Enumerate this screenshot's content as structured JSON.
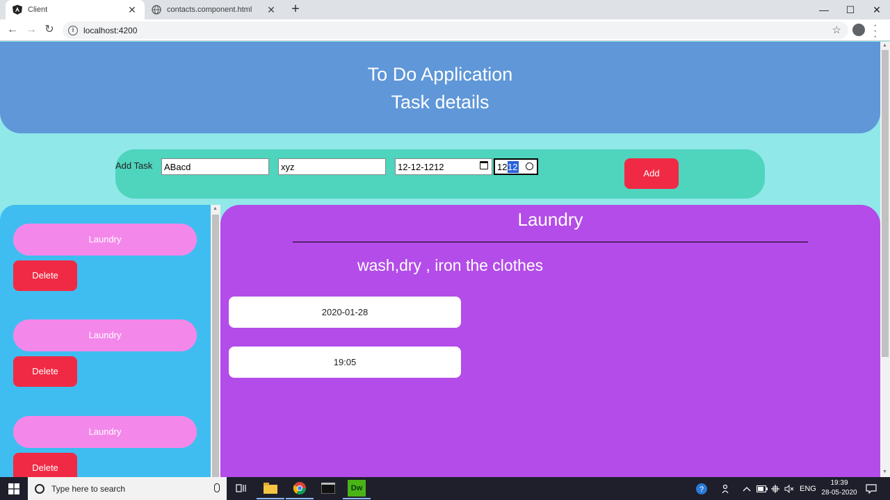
{
  "browser": {
    "tabs": [
      {
        "title": "Client",
        "active": true
      },
      {
        "title": "contacts.component.html",
        "active": false
      }
    ],
    "url": "localhost:4200"
  },
  "header": {
    "title": "To Do Application",
    "subtitle": "Task details"
  },
  "add_task": {
    "label": "Add Task",
    "task_name": "ABacd",
    "task_desc": "xyz",
    "date": "12-12-1212",
    "time_hour": "12:",
    "time_minute": "12",
    "button": "Add"
  },
  "task_list": [
    {
      "name": "Laundry",
      "delete_label": "Delete"
    },
    {
      "name": "Laundry",
      "delete_label": "Delete"
    },
    {
      "name": "Laundry",
      "delete_label": "Delete"
    }
  ],
  "detail": {
    "title": "Laundry",
    "description": "wash,dry , iron the clothes",
    "date": "2020-01-28",
    "time": "19:05"
  },
  "taskbar": {
    "search_placeholder": "Type here to search",
    "language": "ENG",
    "time": "19:39",
    "date": "28-05-2020",
    "dw_label": "Dw"
  },
  "colors": {
    "page_bg": "#91e8e8",
    "header": "#5f97d8",
    "add_bar": "#4fd4bd",
    "sidebar": "#40bdf0",
    "task_pill": "#f488ea",
    "danger": "#f02a45",
    "detail": "#b34ce8"
  }
}
